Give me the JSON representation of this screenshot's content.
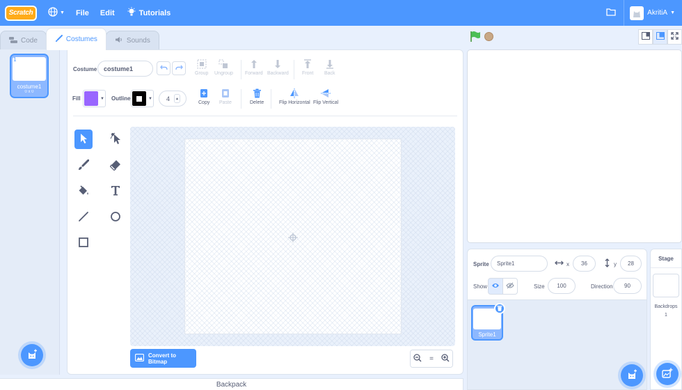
{
  "menubar": {
    "logo": "Scratch",
    "file": "File",
    "edit": "Edit",
    "tutorials": "Tutorials",
    "account": "AkritiA"
  },
  "tabs": [
    {
      "label": "Code"
    },
    {
      "label": "Costumes"
    },
    {
      "label": "Sounds"
    }
  ],
  "costumes": {
    "items": [
      {
        "number": "1",
        "name": "costume1",
        "size": "0 x 0"
      }
    ]
  },
  "toolbar": {
    "costume_label": "Costume",
    "costume_name": "costume1",
    "group": "Group",
    "ungroup": "Ungroup",
    "forward": "Forward",
    "backward": "Backward",
    "front": "Front",
    "back": "Back",
    "fill_label": "Fill",
    "outline_label": "Outline",
    "stroke_width": "4",
    "copy": "Copy",
    "paste": "Paste",
    "delete": "Delete",
    "flip_horizontal": "Flip Horizontal",
    "flip_vertical": "Flip Vertical"
  },
  "colors": {
    "fill": "#9966ff",
    "outline": "#000000",
    "accent": "#4c97ff"
  },
  "canvas": {
    "convert_button": "Convert to Bitmap",
    "zoom_reset": "="
  },
  "backpack": {
    "label": "Backpack"
  },
  "sprite": {
    "label": "Sprite",
    "name": "Sprite1",
    "x_label": "x",
    "x": "36",
    "y_label": "y",
    "y": "28",
    "show_label": "Show",
    "size_label": "Size",
    "size": "100",
    "direction_label": "Direction",
    "direction": "90"
  },
  "sprites": {
    "items": [
      {
        "name": "Sprite1"
      }
    ]
  },
  "stage_pane": {
    "title": "Stage",
    "backdrops_label": "Backdrops",
    "backdrops_count": "1"
  }
}
